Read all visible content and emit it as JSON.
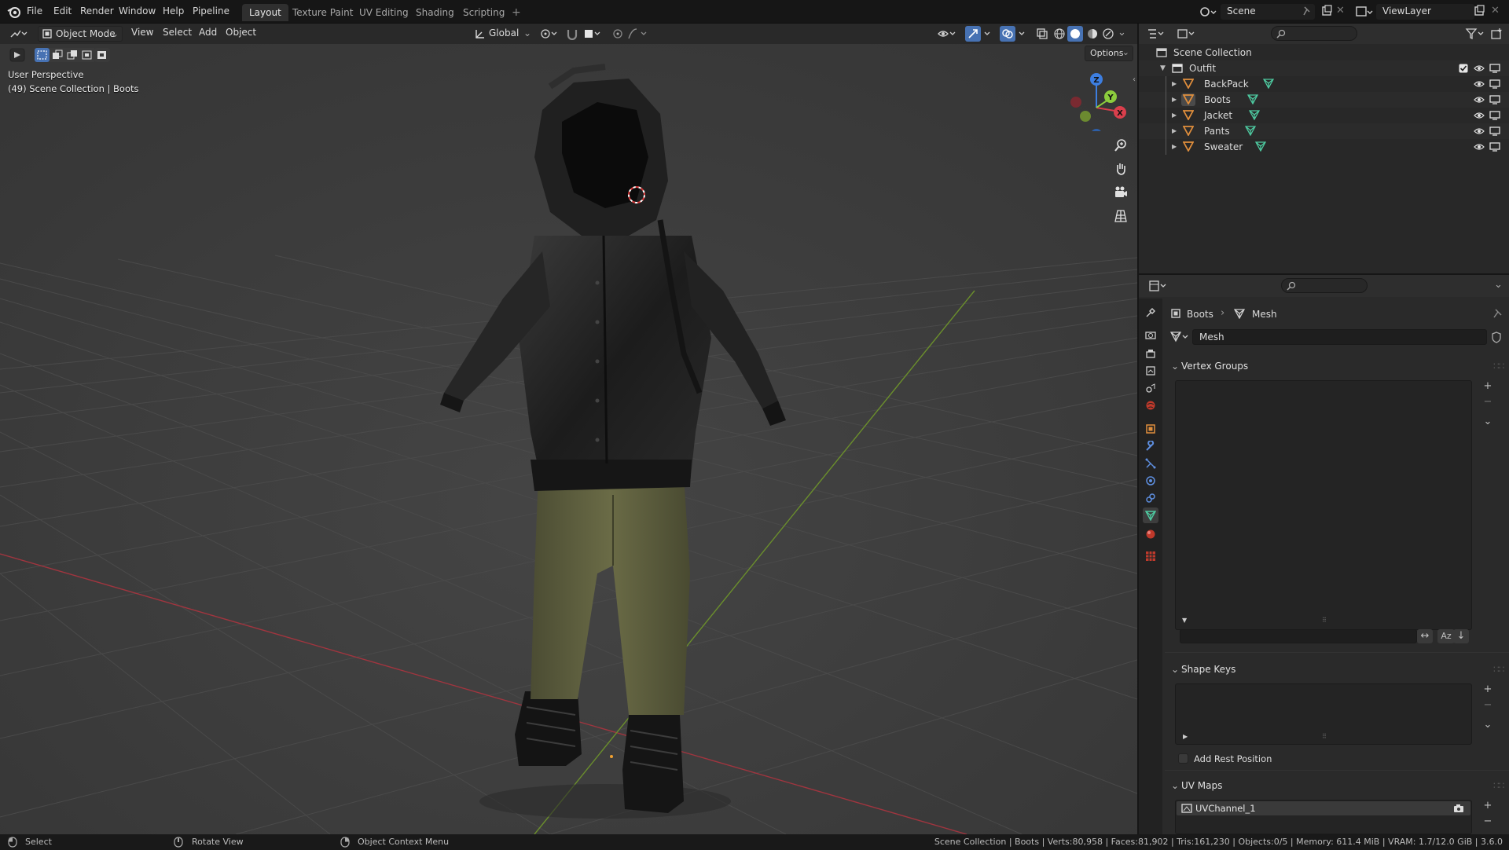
{
  "topbar": {
    "menus": [
      "File",
      "Edit",
      "Render",
      "Window",
      "Help",
      "Pipeline"
    ],
    "workspace_tabs": [
      "Layout",
      "Texture Paint",
      "UV Editing",
      "Shading",
      "Scripting"
    ],
    "active_tab": "Layout",
    "add_tab": "+",
    "scene_name": "Scene",
    "view_layer": "ViewLayer"
  },
  "viewport": {
    "mode": "Object Mode",
    "menus": [
      "View",
      "Select",
      "Add",
      "Object"
    ],
    "transform_orientation": "Global",
    "options_label": "Options",
    "perspective_label": "User Perspective",
    "collection_label": "(49) Scene Collection | Boots",
    "gizmo_axes": {
      "x": "X",
      "y": "Y",
      "z": "Z"
    }
  },
  "outliner": {
    "root": "Scene Collection",
    "collection": "Outfit",
    "objects": [
      "BackPack",
      "Boots",
      "Jacket",
      "Pants",
      "Sweater"
    ]
  },
  "properties": {
    "breadcrumb_object": "Boots",
    "breadcrumb_data": "Mesh",
    "mesh_name": "Mesh",
    "vertex_groups_label": "Vertex Groups",
    "shape_keys_label": "Shape Keys",
    "add_rest_position_label": "Add Rest Position",
    "uv_maps_label": "UV Maps",
    "uv_channel": "UVChannel_1",
    "sort_label": "Az"
  },
  "statusbar": {
    "select": "Select",
    "rotate": "Rotate View",
    "context_menu": "Object Context Menu",
    "stats": "Scene Collection | Boots | Verts:80,958 | Faces:81,902 | Tris:161,230 | Objects:0/5 | Memory: 611.4 MiB | VRAM: 1.7/12.0 GiB | 3.6.0"
  },
  "colors": {
    "accent": "#4772b3",
    "x_axis": "#d93f4c",
    "y_axis": "#8ccc3d",
    "z_axis": "#3d7ee0",
    "mesh_icon": "#4ec9a0",
    "object_icon": "#e08e3c"
  }
}
